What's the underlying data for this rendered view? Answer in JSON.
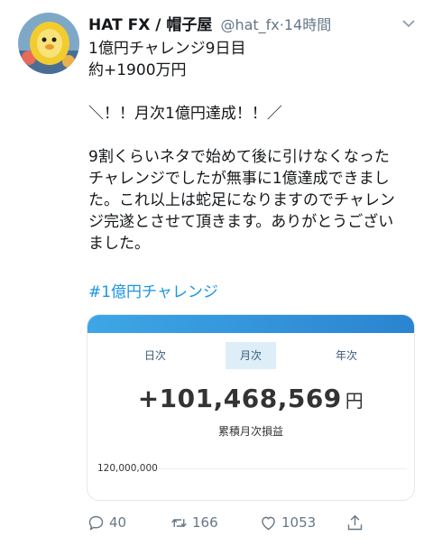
{
  "tweet": {
    "display_name": "HAT FX / 帽子屋",
    "handle": "@hat_fx",
    "separator": "·",
    "time": "14時間",
    "body": "1億円チャレンジ9日目\n約+1900万円\n\n＼！！月次1億円達成！！／\n\n9割くらいネタで始めて後に引けなくなった\nチャレンジでしたが無事に1億達成できまし\nた。これ以上は蛇足になりますのでチャレン\nジ完遂とさせて頂きます。ありがとうござい\nました。",
    "hashtag": "#1億円チャレンジ"
  },
  "card": {
    "tabs": [
      "日次",
      "月次",
      "年次"
    ],
    "active_tab": "月次",
    "amount": "+101,468,569",
    "currency": "円",
    "amount_label": "累積月次損益",
    "axis_label": "120,000,000"
  },
  "actions": {
    "replies": "40",
    "retweets": "166",
    "likes": "1053"
  },
  "icons": [
    "avatar-icon",
    "chevron-down-icon",
    "reply-icon",
    "retweet-icon",
    "like-icon",
    "share-icon"
  ],
  "colors": {
    "link": "#1b95e0",
    "meta": "#657786",
    "card_header": "#2a84d1"
  }
}
